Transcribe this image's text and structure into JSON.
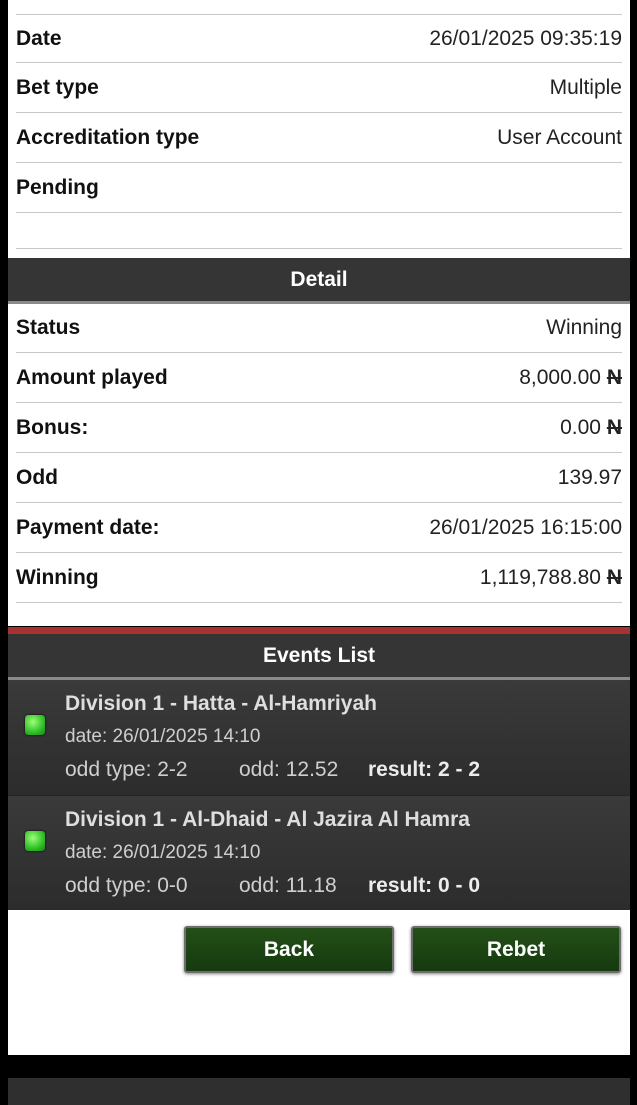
{
  "summary": {
    "rows": [
      {
        "label": "Date",
        "value": "26/01/2025 09:35:19"
      },
      {
        "label": "Bet type",
        "value": "Multiple"
      },
      {
        "label": "Accreditation type",
        "value": "User Account"
      },
      {
        "label": "Pending",
        "value": ""
      }
    ]
  },
  "detail": {
    "title": "Detail",
    "rows": [
      {
        "label": "Status",
        "value": "Winning"
      },
      {
        "label": "Amount played",
        "value": "8,000.00 ",
        "currency": "N"
      },
      {
        "label": "Bonus:",
        "value": "0.00 ",
        "currency": "N"
      },
      {
        "label": "Odd",
        "value": "139.97"
      },
      {
        "label": "Payment date:",
        "value": "26/01/2025 16:15:00"
      },
      {
        "label": "Winning",
        "value": "1,119,788.80 ",
        "currency": "N"
      }
    ]
  },
  "events": {
    "title": "Events List",
    "items": [
      {
        "title": "Division 1 - Hatta - Al-Hamriyah",
        "date": "date: 26/01/2025 14:10",
        "odd_type": "odd type: 2-2",
        "odd": "odd: 12.52",
        "result": "result: 2 - 2",
        "status_color": "#2fbf26"
      },
      {
        "title": "Division 1 - Al-Dhaid - Al Jazira Al Hamra",
        "date": "date: 26/01/2025 14:10",
        "odd_type": "odd type: 0-0",
        "odd": "odd: 11.18",
        "result": "result: 0 - 0",
        "status_color": "#2fbf26"
      }
    ]
  },
  "actions": {
    "back_label": "Back",
    "rebet_label": "Rebet"
  },
  "colors": {
    "header_bg": "#353535",
    "accent_red": "#a83232",
    "button_green": "#1f4a15"
  }
}
